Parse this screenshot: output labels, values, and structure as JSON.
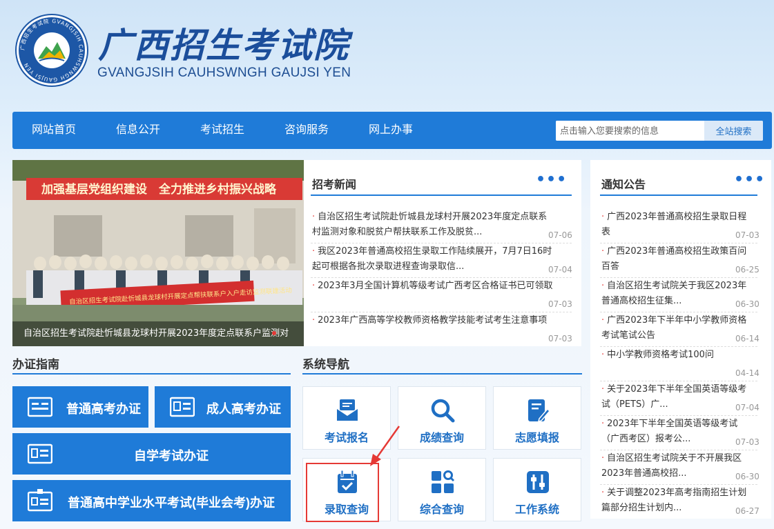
{
  "header": {
    "title": "广西招生考试院",
    "subtitle": "GVANGJSIH CAUHSWNGH GAUJSI YEN",
    "logo_ring_text": "广西招生考试院 GVANGJSIH CAUHSWNGH GAUJSI YEN"
  },
  "nav": {
    "items": [
      "网站首页",
      "信息公开",
      "考试招生",
      "咨询服务",
      "网上办事"
    ],
    "search_placeholder": "点击输入您要搜索的信息",
    "search_button": "全站搜索"
  },
  "slider": {
    "banner_text": "加强基层党组织建设　全力推进乡村振兴战略",
    "red_banner_text": "自治区招生考试院赴忻城县龙球村开展定点帮扶联系户入户走访监测联建活动",
    "caption": "自治区招生考试院赴忻城县龙球村开展2023年度定点联系户监测对"
  },
  "news": {
    "title": "招考新闻",
    "more": "•••",
    "items": [
      {
        "line1": "自治区招生考试院赴忻城县龙球村开展2023年度定点联系",
        "line2": "村监测对象和脱贫户帮扶联系工作及脱贫...",
        "date": "07-06"
      },
      {
        "line1": "我区2023年普通高校招生录取工作陆续展开，7月7日16时",
        "line2": "起可根据各批次录取进程查询录取信...",
        "date": "07-04"
      },
      {
        "line1": "2023年3月全国计算机等级考试广西考区合格证书已可领取",
        "line2": "",
        "date": "07-03"
      },
      {
        "line1": "2023年广西高等学校教师资格教学技能考试考生注意事项",
        "line2": "",
        "date": "07-03"
      }
    ]
  },
  "notices": {
    "title": "通知公告",
    "more": "•••",
    "items": [
      {
        "line1": "广西2023年普通高校招生录取日程",
        "line2": "表",
        "date": "07-03"
      },
      {
        "line1": "广西2023年普通高校招生政策百问",
        "line2": "百答",
        "date": "06-25"
      },
      {
        "line1": "自治区招生考试院关于我区2023年",
        "line2": "普通高校招生征集...",
        "date": "06-30"
      },
      {
        "line1": "广西2023年下半年中小学教师资格",
        "line2": "考试笔试公告",
        "date": "06-14"
      },
      {
        "line1": "中小学教师资格考试100问",
        "line2": "",
        "date": "04-14"
      },
      {
        "line1": "关于2023年下半年全国英语等级考",
        "line2": "试（PETS）广...",
        "date": "07-04"
      },
      {
        "line1": "2023年下半年全国英语等级考试",
        "line2": "（广西考区）报考公...",
        "date": "07-03"
      },
      {
        "line1": "自治区招生考试院关于不开展我区",
        "line2": "2023年普通高校招...",
        "date": "06-30"
      },
      {
        "line1": "关于调整2023年高考指南招生计划",
        "line2": "篇部分招生计划内...",
        "date": "06-27"
      }
    ]
  },
  "guide": {
    "title": "办证指南",
    "buttons": [
      "普通高考办证",
      "成人高考办证",
      "自学考试办证",
      "普通高中学业水平考试(毕业会考)办证"
    ]
  },
  "system_nav": {
    "title": "系统导航",
    "tiles": [
      {
        "label": "考试报名",
        "icon": "registration-icon"
      },
      {
        "label": "成绩查询",
        "icon": "search-icon"
      },
      {
        "label": "志愿填报",
        "icon": "form-edit-icon"
      },
      {
        "label": "录取查询",
        "icon": "calendar-check-icon"
      },
      {
        "label": "综合查询",
        "icon": "grid-search-icon"
      },
      {
        "label": "工作系统",
        "icon": "sliders-icon"
      }
    ]
  },
  "colors": {
    "primary": "#1f7bd8",
    "title_blue": "#1b4e9b",
    "accent_red": "#e53935"
  }
}
